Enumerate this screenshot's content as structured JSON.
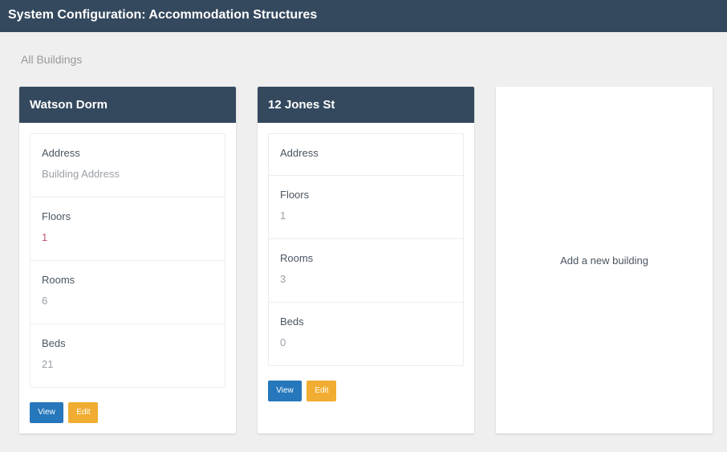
{
  "header": {
    "title": "System Configuration: Accommodation Structures"
  },
  "section": {
    "title": "All Buildings"
  },
  "buildings": [
    {
      "name": "Watson Dorm",
      "fields": [
        {
          "label": "Address",
          "value": "Building Address"
        },
        {
          "label": "Floors",
          "value": "1"
        },
        {
          "label": "Rooms",
          "value": "6"
        },
        {
          "label": "Beds",
          "value": "21"
        }
      ],
      "view_label": "View",
      "edit_label": "Edit"
    },
    {
      "name": "12 Jones St",
      "fields": [
        {
          "label": "Address",
          "value": ""
        },
        {
          "label": "Floors",
          "value": "1"
        },
        {
          "label": "Rooms",
          "value": "3"
        },
        {
          "label": "Beds",
          "value": "0"
        }
      ],
      "view_label": "View",
      "edit_label": "Edit"
    }
  ],
  "add_card": {
    "label": "Add a new building"
  },
  "colors": {
    "header_bg": "#34495e",
    "page_bg": "#efefef",
    "view_button": "#2677bb",
    "edit_button": "#f0ad31"
  }
}
